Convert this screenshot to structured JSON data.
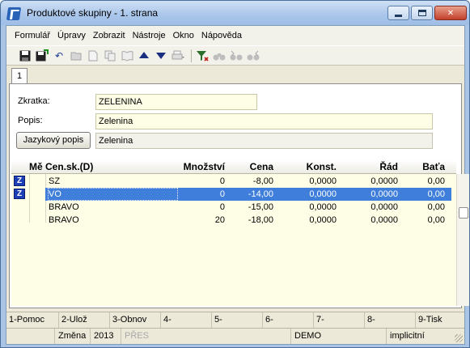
{
  "window": {
    "title": "Produktové skupiny - 1. strana",
    "close_glyph": "✕"
  },
  "menu": [
    "Formulář",
    "Úpravy",
    "Zobrazit",
    "Nástroje",
    "Okno",
    "Nápověda"
  ],
  "toolbar": {
    "icons": [
      "save-icon",
      "save-as-icon",
      "undo-icon",
      "open-folder-icon",
      "new-document-icon",
      "copy-icon",
      "book-icon",
      "arrow-up-icon",
      "arrow-down-icon",
      "print-icon",
      "filter-icon",
      "binoculars-icon",
      "binoculars-prev-icon",
      "binoculars-next-icon"
    ]
  },
  "tab": {
    "label": "1"
  },
  "form": {
    "zkratka_label": "Zkratka:",
    "zkratka_value": "ZELENINA",
    "popis_label": "Popis:",
    "popis_value": "Zelenina",
    "jazykovy_button": "Jazykový popis",
    "jazykovy_value": "Zelenina"
  },
  "grid": {
    "headers": {
      "me": "Mě",
      "censk": "Cen.sk.(D)",
      "mnozstvi": "Množství",
      "cena": "Cena",
      "konst": "Konst.",
      "rad": "Řád",
      "bata": "Baťa"
    },
    "rows": [
      {
        "flag": "Z",
        "censk": "SZ",
        "mnozstvi": "0",
        "cena": "-8,00",
        "konst": "0,0000",
        "rad": "0,0000",
        "bata": "0,00"
      },
      {
        "flag": "Z",
        "censk": "VO",
        "mnozstvi": "0",
        "cena": "-14,00",
        "konst": "0,0000",
        "rad": "0,0000",
        "bata": "0,00"
      },
      {
        "flag": "",
        "censk": "BRAVO",
        "mnozstvi": "0",
        "cena": "-15,00",
        "konst": "0,0000",
        "rad": "0,0000",
        "bata": "0,00"
      },
      {
        "flag": "",
        "censk": "BRAVO",
        "mnozstvi": "20",
        "cena": "-18,00",
        "konst": "0,0000",
        "rad": "0,0000",
        "bata": "0,00"
      }
    ]
  },
  "fkeys": [
    "1-Pomoc",
    "2-Ulož",
    "3-Obnov",
    "4-",
    "5-",
    "6-",
    "7-",
    "8-",
    "9-Tisk"
  ],
  "status": {
    "mode": "Změna",
    "year": "2013",
    "pres": "PŘES",
    "db": "DEMO",
    "profile": "implicitní"
  }
}
